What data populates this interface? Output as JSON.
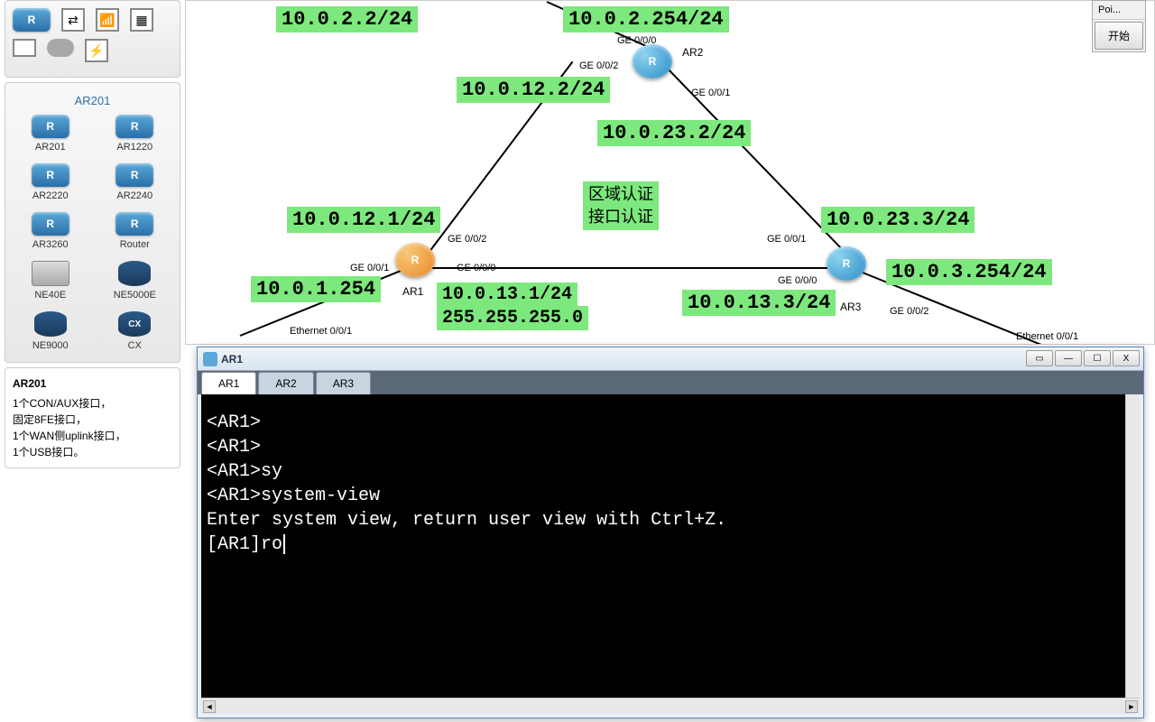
{
  "toolbox": {
    "row1": [
      "R",
      "⇄",
      "📶",
      "▦"
    ],
    "row2": [
      "🖵",
      "☁",
      "⚡"
    ]
  },
  "palette": {
    "header": "AR201",
    "devices": [
      {
        "label": "AR201",
        "type": "router"
      },
      {
        "label": "AR1220",
        "type": "router"
      },
      {
        "label": "AR2220",
        "type": "router"
      },
      {
        "label": "AR2240",
        "type": "router"
      },
      {
        "label": "AR3260",
        "type": "router"
      },
      {
        "label": "Router",
        "type": "router"
      },
      {
        "label": "NE40E",
        "type": "chassis"
      },
      {
        "label": "NE5000E",
        "type": "drum"
      },
      {
        "label": "NE9000",
        "type": "drum"
      },
      {
        "label": "CX",
        "type": "cx"
      }
    ]
  },
  "info": {
    "title": "AR201",
    "line1": "1个CON/AUX接口，",
    "line2": "固定8FE接口，",
    "line3": "1个WAN侧uplink接口，",
    "line4": "1个USB接口。"
  },
  "top_toolbar": {
    "item1": "Poi...",
    "button": "开始"
  },
  "topology": {
    "labels": {
      "ip1": "10.0.2.2/24",
      "ip2": "10.0.2.254/24",
      "ip3": "10.0.12.2/24",
      "ip4": "10.0.23.2/24",
      "ip5": "10.0.12.1/24",
      "ip6": "10.0.23.3/24",
      "ip7": "10.0.1.254",
      "ip8": "10.0.13.1/24",
      "ip9": "255.255.255.0",
      "ip10": "10.0.13.3/24",
      "ip11": "10.0.3.254/24",
      "auth1": "区域认证",
      "auth2": "接口认证"
    },
    "nodes": {
      "ar1": "AR1",
      "ar2": "AR2",
      "ar3": "AR3",
      "r_glyph": "R"
    },
    "ports": {
      "p1": "GE 0/0/0",
      "p2": "GE 0/0/2",
      "p3": "GE 0/0/1",
      "p4": "GE 0/0/2",
      "p5": "GE 0/0/1",
      "p6": "GE 0/0/0",
      "p7": "Ethernet 0/0/1",
      "p8": "GE 0/0/1",
      "p9": "GE 0/0/0",
      "p10": "GE 0/0/2",
      "p11": "Ethernet 0/0/1"
    }
  },
  "terminal": {
    "title": "AR1",
    "tabs": [
      "AR1",
      "AR2",
      "AR3"
    ],
    "active_tab": 0,
    "lines": [
      "<AR1>",
      "<AR1>",
      "<AR1>sy",
      "<AR1>system-view",
      "Enter system view, return user view with Ctrl+Z.",
      "[AR1]ro"
    ],
    "controls": {
      "extra": "▭",
      "min": "—",
      "max": "☐",
      "close": "X"
    },
    "scroll": {
      "left": "◄",
      "right": "►"
    }
  }
}
